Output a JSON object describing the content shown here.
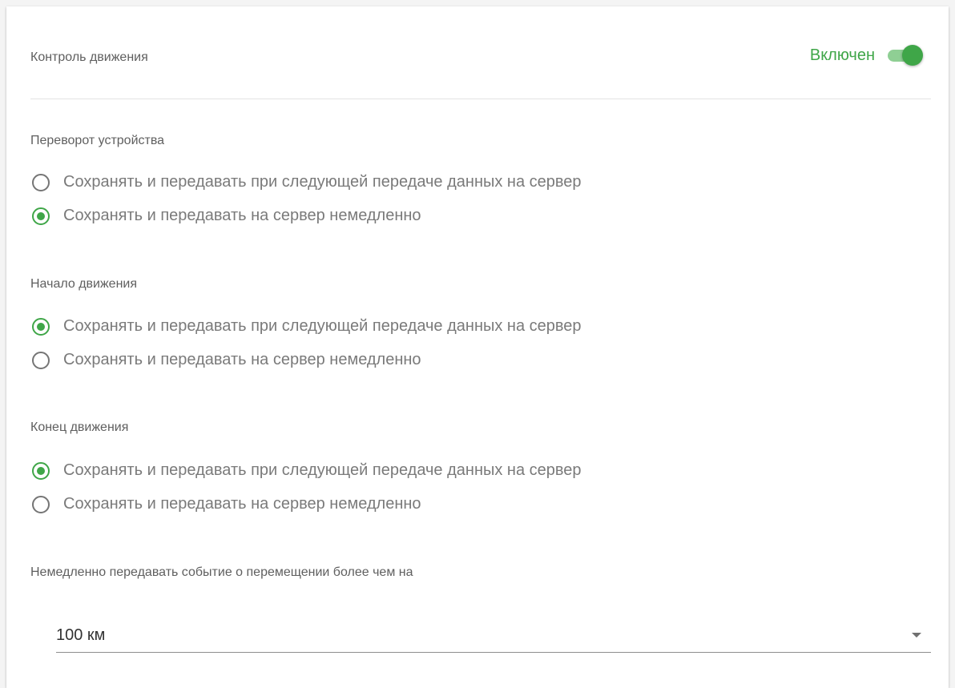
{
  "header": {
    "title": "Контроль движения",
    "toggle": {
      "label": "Включен",
      "on": true
    }
  },
  "groups": [
    {
      "title": "Переворот устройства",
      "options": [
        {
          "label": "Сохранять и передавать при следующей передаче данных на сервер",
          "checked": false
        },
        {
          "label": "Сохранять и передавать на сервер немедленно",
          "checked": true
        }
      ]
    },
    {
      "title": "Начало движения",
      "options": [
        {
          "label": "Сохранять и передавать при следующей передаче данных на сервер",
          "checked": true
        },
        {
          "label": "Сохранять и передавать на сервер немедленно",
          "checked": false
        }
      ]
    },
    {
      "title": "Конец движения",
      "options": [
        {
          "label": "Сохранять и передавать при следующей передаче данных на сервер",
          "checked": true
        },
        {
          "label": "Сохранять и передавать на сервер немедленно",
          "checked": false
        }
      ]
    }
  ],
  "distance": {
    "title": "Немедленно передавать событие о перемещении более чем на",
    "value": "100 км"
  },
  "colors": {
    "accent": "#3fa648",
    "track": "#8fcf94",
    "text_secondary": "#7a7a7a",
    "text_title": "#5f5f5f"
  }
}
